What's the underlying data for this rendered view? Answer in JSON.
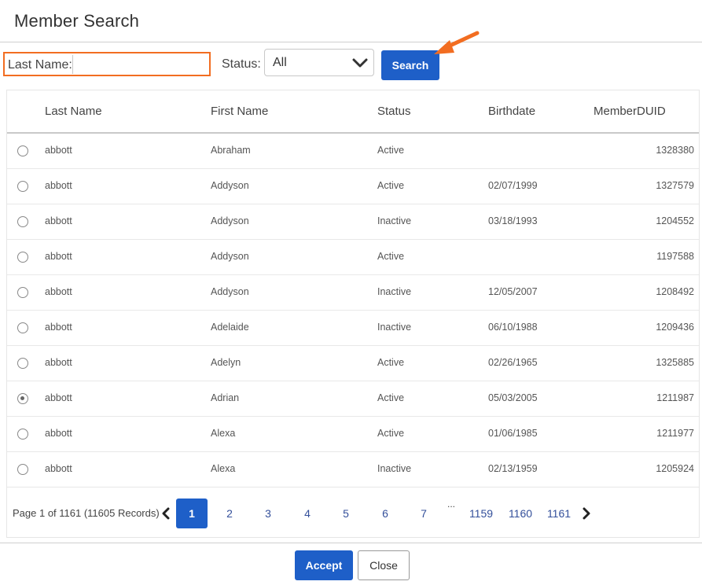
{
  "dialog": {
    "title": "Member Search"
  },
  "filters": {
    "last_name_label": "Last Name:",
    "last_name_value": "",
    "status_label": "Status:",
    "status_value": "All",
    "search_label": "Search"
  },
  "table": {
    "headers": [
      "Last Name",
      "First Name",
      "Status",
      "Birthdate",
      "MemberDUID"
    ],
    "rows": [
      {
        "selected": false,
        "last": "abbott",
        "first": "Abraham",
        "status": "Active",
        "birth": "",
        "duid": "1328380"
      },
      {
        "selected": false,
        "last": "abbott",
        "first": "Addyson",
        "status": "Active",
        "birth": "02/07/1999",
        "duid": "1327579"
      },
      {
        "selected": false,
        "last": "abbott",
        "first": "Addyson",
        "status": "Inactive",
        "birth": "03/18/1993",
        "duid": "1204552"
      },
      {
        "selected": false,
        "last": "abbott",
        "first": "Addyson",
        "status": "Active",
        "birth": "",
        "duid": "1197588"
      },
      {
        "selected": false,
        "last": "abbott",
        "first": "Addyson",
        "status": "Inactive",
        "birth": "12/05/2007",
        "duid": "1208492"
      },
      {
        "selected": false,
        "last": "abbott",
        "first": "Adelaide",
        "status": "Inactive",
        "birth": "06/10/1988",
        "duid": "1209436"
      },
      {
        "selected": false,
        "last": "abbott",
        "first": "Adelyn",
        "status": "Active",
        "birth": "02/26/1965",
        "duid": "1325885"
      },
      {
        "selected": true,
        "last": "abbott",
        "first": "Adrian",
        "status": "Active",
        "birth": "05/03/2005",
        "duid": "1211987"
      },
      {
        "selected": false,
        "last": "abbott",
        "first": "Alexa",
        "status": "Active",
        "birth": "01/06/1985",
        "duid": "1211977"
      },
      {
        "selected": false,
        "last": "abbott",
        "first": "Alexa",
        "status": "Inactive",
        "birth": "02/13/1959",
        "duid": "1205924"
      }
    ]
  },
  "pager": {
    "info": "Page 1 of 1161 (11605 Records)",
    "pages": [
      "1",
      "2",
      "3",
      "4",
      "5",
      "6",
      "7",
      "1159",
      "1160",
      "1161"
    ],
    "current": "1",
    "ellipsis": "..."
  },
  "footer": {
    "accept_label": "Accept",
    "close_label": "Close"
  },
  "colors": {
    "primary": "#1e5fc8",
    "highlight": "#f26d21"
  },
  "icons": [
    "chevron-down-icon",
    "chevron-left-icon",
    "chevron-right-icon",
    "arrow-annotation-icon"
  ]
}
